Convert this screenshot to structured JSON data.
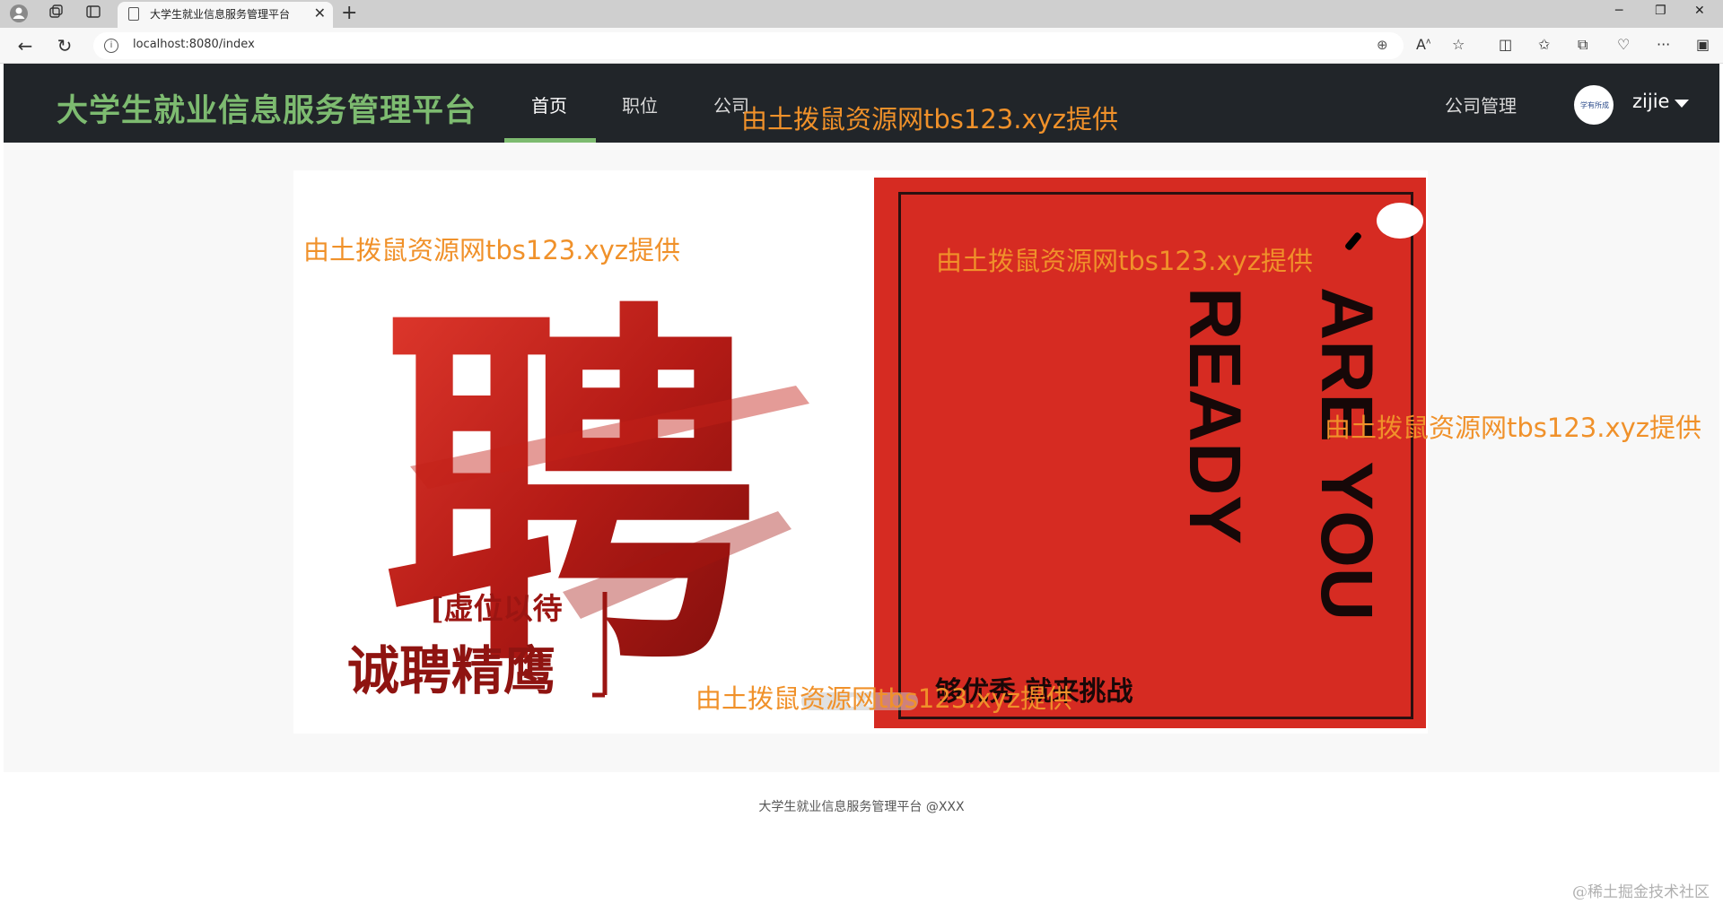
{
  "browser": {
    "tab_title": "大学生就业信息服务管理平台",
    "url": "localhost:8080/index",
    "new_tab_symbol": "+",
    "icons": [
      "profile-icon",
      "collections-icon",
      "tab-actions-icon",
      "document-icon",
      "close-icon",
      "back-icon",
      "refresh-icon",
      "info-icon",
      "zoom-icon",
      "read-aloud-icon",
      "favorite-star-icon",
      "split-screen-icon",
      "favorites-icon",
      "collections-icon",
      "extensions-icon",
      "more-icon",
      "sidebar-icon",
      "minimize-icon",
      "restore-icon",
      "window-close-icon"
    ]
  },
  "navbar": {
    "brand": "大学生就业信息服务管理平台",
    "links": [
      {
        "label": "首页",
        "active": true
      },
      {
        "label": "职位",
        "active": false
      },
      {
        "label": "公司",
        "active": false
      }
    ],
    "right_link": "公司管理",
    "username": "zijie",
    "avatar_text": "学有所成",
    "accent_color": "#7dbb70",
    "bg_color": "#212529"
  },
  "carousel": {
    "slide_left": {
      "big_char": "聘",
      "subtitle": "[虚位以待",
      "title": "诚聘精鹰"
    },
    "slide_right": {
      "line1": "ARE YOU",
      "line2": "READY",
      "tagline": "够优秀 就来挑战",
      "bg_color": "#d62b22"
    },
    "indicator_count": 2,
    "active_index": 0
  },
  "footer": {
    "text": "大学生就业信息服务管理平台 @XXX"
  },
  "watermarks": [
    "由土拨鼠资源网tbs123.xyz提供",
    "由土拨鼠资源网tbs123.xyz提供",
    "由土拨鼠资源网tbs123.xyz提供",
    "由土拨鼠资源网tbs123.xyz提供",
    "由土拨鼠资源网tbs123.xyz提供"
  ],
  "corner_mark": "@稀土掘金技术社区"
}
